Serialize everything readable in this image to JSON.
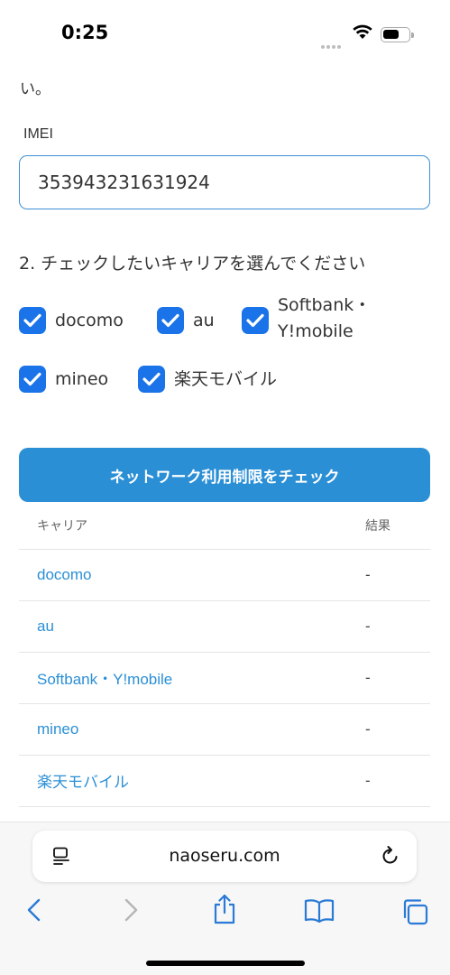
{
  "status_bar": {
    "time": "0:25"
  },
  "page": {
    "cut_text": "い。",
    "imei_label": "IMEI",
    "imei_value": "353943231631924",
    "section_title": "2. チェックしたいキャリアを選んでください",
    "carriers": [
      {
        "label": "docomo",
        "checked": true
      },
      {
        "label": "au",
        "checked": true
      },
      {
        "label": "Softbank・",
        "label2": "Y!mobile",
        "checked": true
      },
      {
        "label": "mineo",
        "checked": true
      },
      {
        "label": "楽天モバイル",
        "checked": true
      }
    ],
    "check_button": "ネットワーク利用制限をチェック",
    "table": {
      "header_carrier": "キャリア",
      "header_result": "結果",
      "rows": [
        {
          "carrier": "docomo",
          "result": "-"
        },
        {
          "carrier": "au",
          "result": "-"
        },
        {
          "carrier": "Softbank・Y!mobile",
          "result": "-"
        },
        {
          "carrier": "mineo",
          "result": "-"
        },
        {
          "carrier": "楽天モバイル",
          "result": "-"
        }
      ]
    }
  },
  "browser": {
    "url": "naoseru.com"
  },
  "colors": {
    "accent": "#2b8fd6",
    "checkbox": "#1a73e8",
    "nav_icon": "#2a7ad6"
  }
}
